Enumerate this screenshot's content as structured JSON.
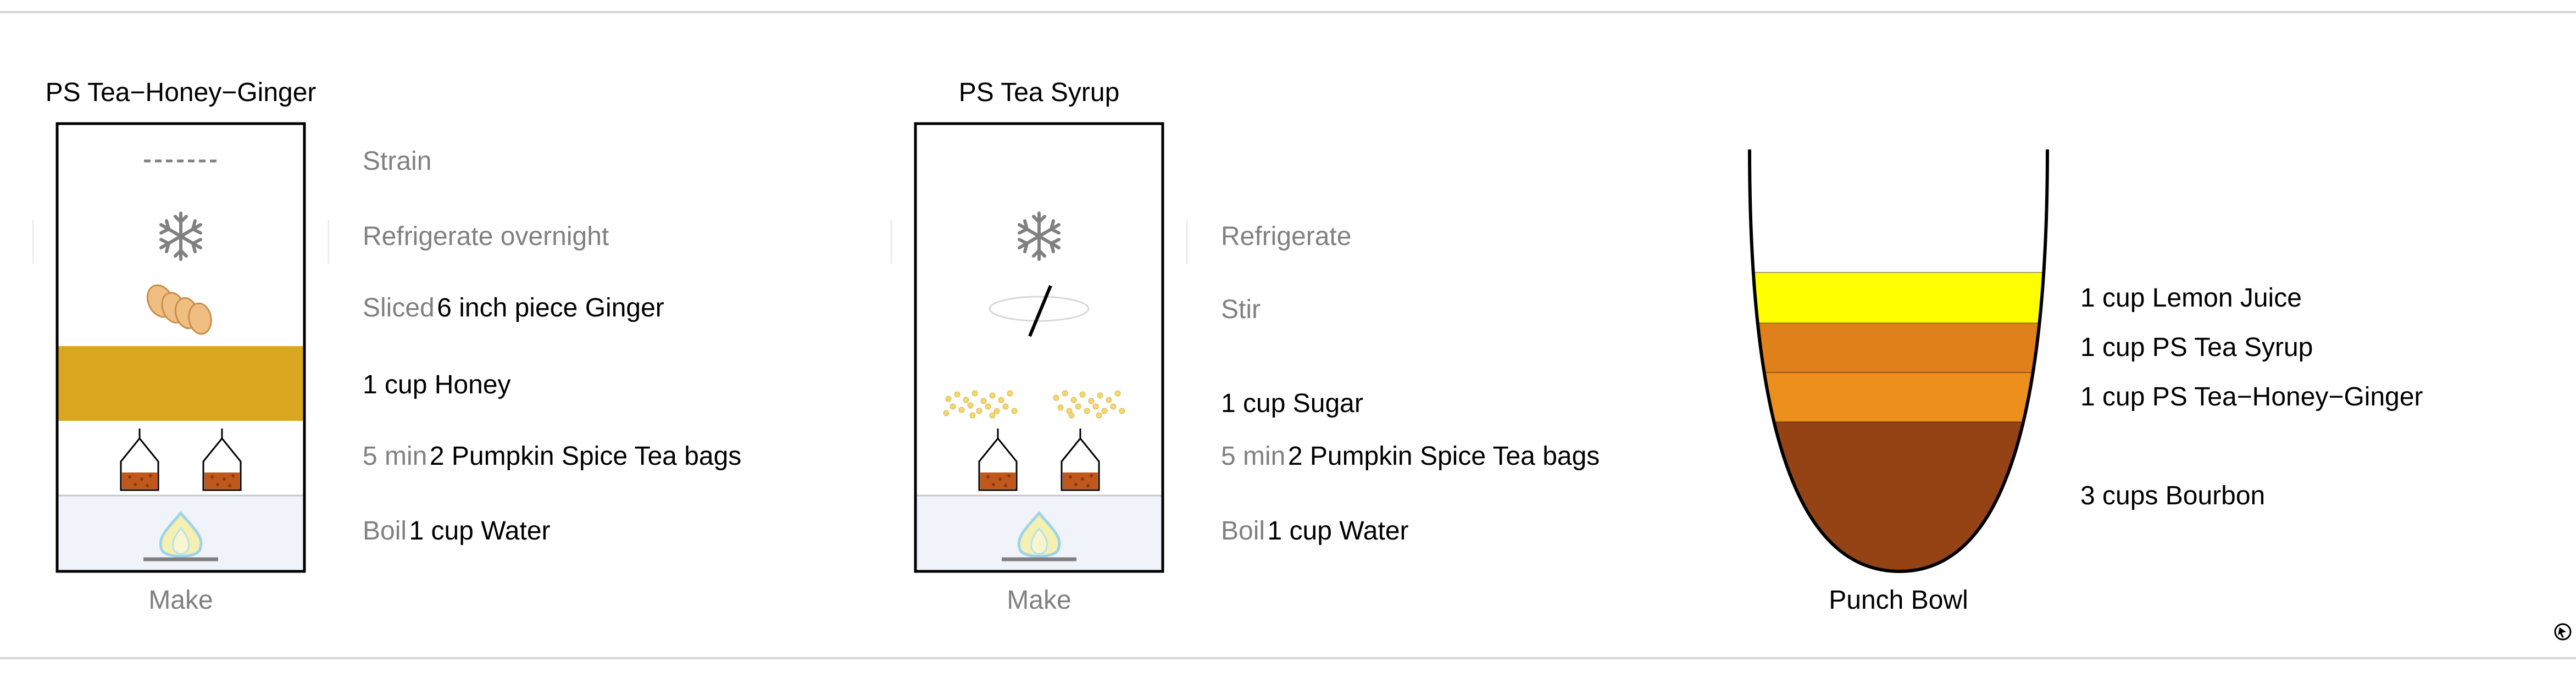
{
  "recipes": [
    {
      "title": "PS Tea−Honey−Ginger",
      "footer": "Make",
      "steps": [
        {
          "icon": "dashed-line-icon",
          "action": "Strain",
          "detail": ""
        },
        {
          "icon": "snowflake-icon",
          "action": "Refrigerate overnight",
          "detail": ""
        },
        {
          "icon": "ginger-icon",
          "action": "Sliced",
          "detail": "6 inch piece Ginger"
        },
        {
          "icon": "honey-layer",
          "action": "",
          "detail": "1 cup Honey"
        },
        {
          "icon": "tea-bag-icon",
          "action": "5 min",
          "detail": "2 Pumpkin Spice Tea bags"
        },
        {
          "icon": "flame-icon",
          "action": "Boil",
          "detail": "1 cup Water"
        }
      ]
    },
    {
      "title": "PS Tea Syrup",
      "footer": "Make",
      "steps": [
        {
          "icon": "snowflake-icon",
          "action": "Refrigerate",
          "detail": ""
        },
        {
          "icon": "stir-icon",
          "action": "Stir",
          "detail": ""
        },
        {
          "icon": "sugar-icon",
          "action": "",
          "detail": "1 cup Sugar"
        },
        {
          "icon": "tea-bag-icon",
          "action": "5 min",
          "detail": "2 Pumpkin Spice Tea bags"
        },
        {
          "icon": "flame-icon",
          "action": "Boil",
          "detail": "1 cup Water"
        }
      ]
    }
  ],
  "punch_bowl": {
    "label": "Punch Bowl",
    "layers": [
      {
        "text": "1 cup Lemon Juice",
        "color": "#ffff00"
      },
      {
        "text": "1 cup PS Tea Syrup",
        "color": "#e0801a"
      },
      {
        "text": "1 cup PS Tea−Honey−Ginger",
        "color": "#ec8f1c"
      },
      {
        "text": "3 cups Bourbon",
        "color": "#954315"
      }
    ]
  },
  "colors": {
    "honey": "#daa520",
    "tea": "#c0581c",
    "flame_bg": "#f1f3fb",
    "flame": "#f3f0b0",
    "flame_outline": "#9fd3e8",
    "sugar": "#f2d773",
    "ginger": "#f0be82",
    "text_grey": "#808080"
  }
}
